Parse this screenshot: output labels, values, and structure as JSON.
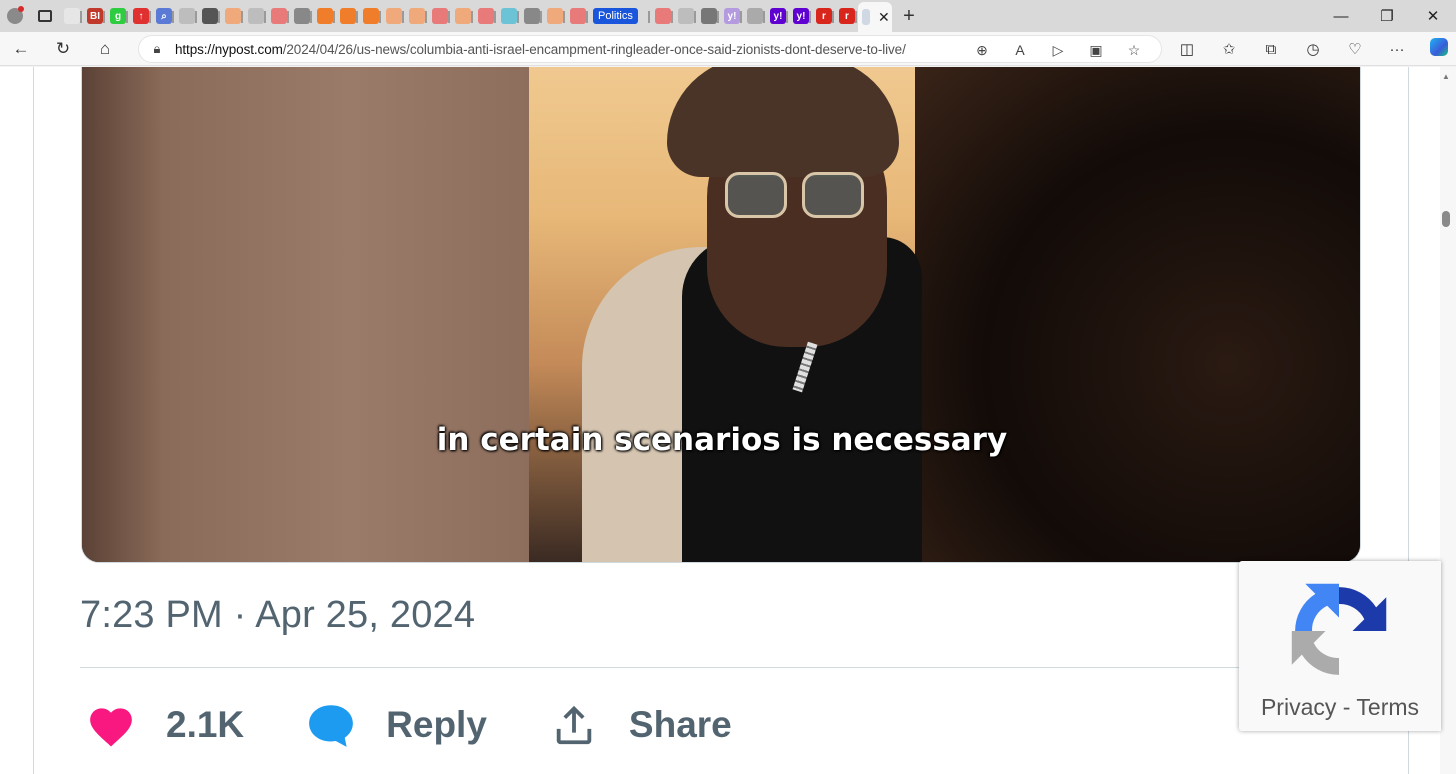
{
  "browser": {
    "tabs": [
      {
        "icon": "blank-page-icon",
        "color": "#e6e6e6"
      },
      {
        "icon": "bi-favicon",
        "text": "BI",
        "color": "#c0392b"
      },
      {
        "icon": "g-favicon",
        "text": "g",
        "color": "#2ecc40"
      },
      {
        "icon": "red-up-favicon",
        "text": "↑",
        "color": "#e03131"
      },
      {
        "icon": "search-favicon",
        "text": "⌕",
        "color": "#5b7ad6"
      },
      {
        "icon": "page-favicon",
        "color": "#bdbdbd"
      },
      {
        "icon": "slash-favicon",
        "color": "#555555"
      },
      {
        "icon": "bookmark-favicon",
        "color": "#f0a97a"
      },
      {
        "icon": "page-favicon",
        "color": "#bdbdbd"
      },
      {
        "icon": "youtube-favicon",
        "color": "#e87a7a"
      },
      {
        "icon": "image-favicon",
        "color": "#888888"
      },
      {
        "icon": "bookmark-favicon",
        "color": "#f07d2a"
      },
      {
        "icon": "bookmark-favicon",
        "color": "#f07d2a"
      },
      {
        "icon": "bookmark-favicon",
        "color": "#f07d2a"
      },
      {
        "icon": "bookmark-favicon",
        "color": "#f0a97a"
      },
      {
        "icon": "bookmark-favicon",
        "color": "#f0a97a"
      },
      {
        "icon": "youtube-favicon",
        "color": "#e87a7a"
      },
      {
        "icon": "bookmark-favicon",
        "color": "#f0a97a"
      },
      {
        "icon": "youtube-favicon",
        "color": "#e87a7a"
      },
      {
        "icon": "p-favicon",
        "color": "#6cc3d5"
      },
      {
        "icon": "image-favicon",
        "color": "#888888"
      },
      {
        "icon": "bookmark-favicon",
        "color": "#f0a97a"
      },
      {
        "icon": "youtube-favicon",
        "color": "#e87a7a"
      }
    ],
    "tabs_after": [
      {
        "icon": "youtube-favicon",
        "color": "#e87a7a"
      },
      {
        "icon": "page-favicon",
        "color": "#bdbdbd"
      },
      {
        "icon": "image-favicon",
        "color": "#777777"
      },
      {
        "icon": "yahoo-favicon",
        "text": "y!",
        "color": "#b49be0"
      },
      {
        "icon": "w-favicon",
        "color": "#aaaaaa"
      },
      {
        "icon": "yahoo-favicon",
        "text": "y!",
        "color": "#5f01d1"
      },
      {
        "icon": "yahoo-favicon",
        "text": "y!",
        "color": "#5f01d1"
      },
      {
        "icon": "r-favicon",
        "text": "r",
        "color": "#d9261c"
      },
      {
        "icon": "r-favicon",
        "text": "r",
        "color": "#d9261c"
      }
    ],
    "politics_chip": "Politics",
    "active_tab_close": "✕",
    "url_host": "https://nypost.com",
    "url_path": "/2024/04/26/us-news/columbia-anti-israel-encampment-ringleader-once-said-zionists-dont-deserve-to-live/"
  },
  "post": {
    "subtitle": "in certain scenarios is necessary",
    "timestamp": "7:23 PM · Apr 25, 2024",
    "likes": "2.1K",
    "reply_label": "Reply",
    "share_label": "Share"
  },
  "recaptcha": {
    "privacy": "Privacy",
    "separator": " - ",
    "terms": "Terms"
  },
  "colors": {
    "heart": "#f91880",
    "reply_bubble": "#1d9bf0",
    "muted_text": "#536471"
  }
}
